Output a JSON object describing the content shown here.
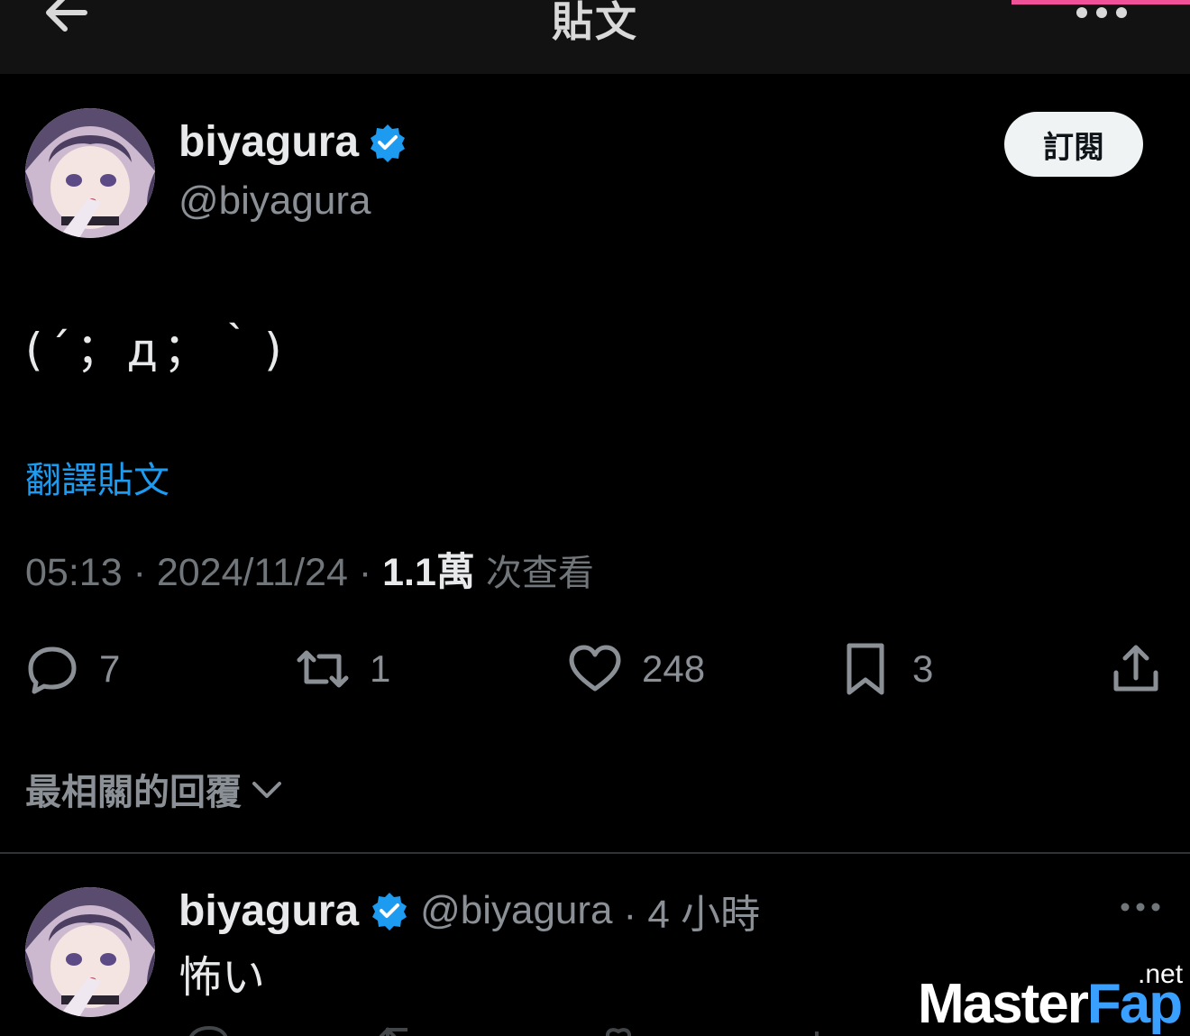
{
  "header": {
    "title": "貼文",
    "back_icon": "arrow-left-icon",
    "more_icon": "more-horizontal-icon"
  },
  "post": {
    "author": {
      "display_name": "biyagura",
      "handle": "@biyagura",
      "verified": true,
      "verified_color": "#1d9bf0"
    },
    "subscribe_label": "訂閱",
    "text": "(´；д；｀)",
    "translate_label": "翻譯貼文",
    "time": "05:13",
    "date": "2024/11/24",
    "separator": "·",
    "views_count": "1.1萬",
    "views_label": "次查看",
    "actions": {
      "reply": {
        "icon": "reply-icon",
        "count": "7"
      },
      "repost": {
        "icon": "repost-icon",
        "count": "1"
      },
      "like": {
        "icon": "heart-icon",
        "count": "248"
      },
      "bookmark": {
        "icon": "bookmark-icon",
        "count": "3"
      },
      "share": {
        "icon": "share-icon"
      }
    }
  },
  "replies": {
    "sort_label": "最相關的回覆",
    "items": [
      {
        "display_name": "biyagura",
        "handle": "@biyagura",
        "time": "· 4 小時",
        "text": "怖い"
      }
    ]
  },
  "watermark": {
    "main_a": "Master",
    "main_b": "Fap",
    "suffix": ".net"
  },
  "colors": {
    "background": "#000000",
    "accent": "#1d9bf0",
    "muted": "#71767b",
    "header_bg": "#121212",
    "pink_strip": "#f0529a"
  }
}
